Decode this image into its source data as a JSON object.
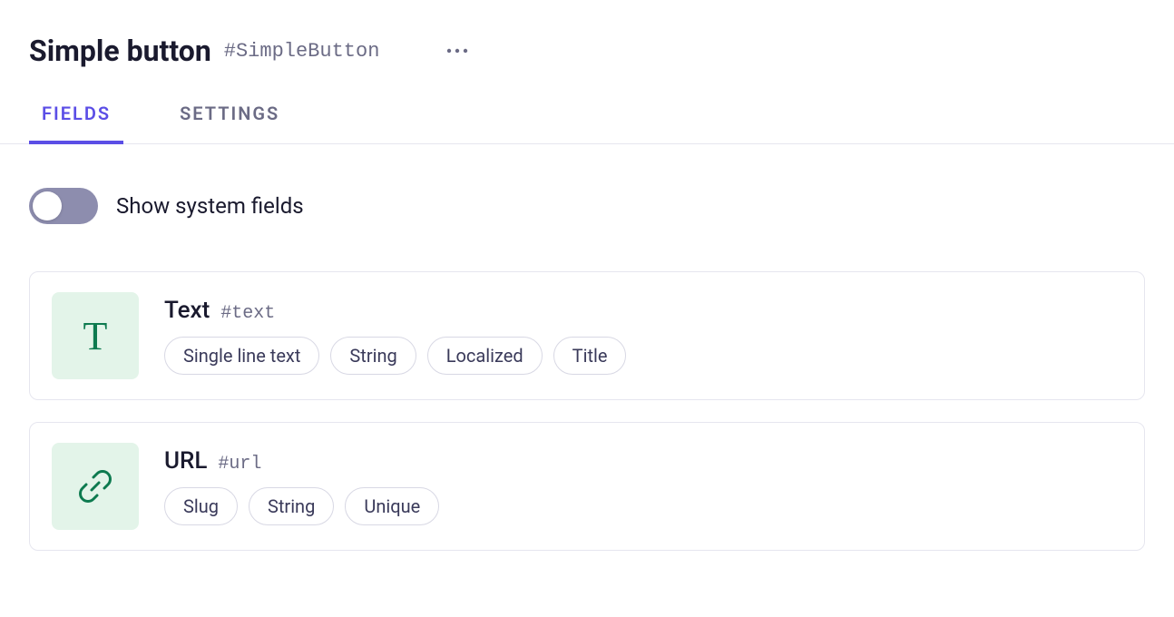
{
  "header": {
    "title": "Simple button",
    "slug": "#SimpleButton"
  },
  "tabs": [
    {
      "label": "FIELDS",
      "active": true
    },
    {
      "label": "SETTINGS",
      "active": false
    }
  ],
  "toggle": {
    "label": "Show system fields",
    "on": false
  },
  "fields": [
    {
      "icon": "text",
      "name": "Text",
      "slug": "#text",
      "tags": [
        "Single line text",
        "String",
        "Localized",
        "Title"
      ]
    },
    {
      "icon": "link",
      "name": "URL",
      "slug": "#url",
      "tags": [
        "Slug",
        "String",
        "Unique"
      ]
    }
  ]
}
